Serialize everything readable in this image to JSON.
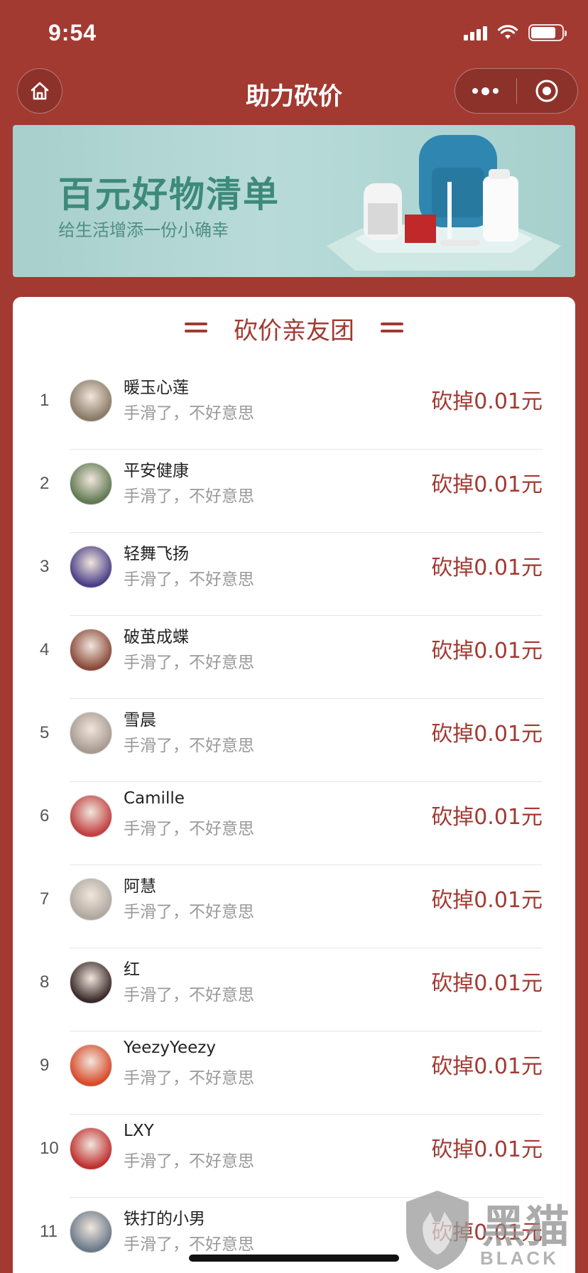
{
  "status_bar": {
    "time": "9:54",
    "battery_level": 0.8
  },
  "nav": {
    "title": "助力砍价"
  },
  "banner": {
    "title": "百元好物清单",
    "subtitle": "给生活增添一份小确幸"
  },
  "section": {
    "title": "砍价亲友团"
  },
  "helpers": [
    {
      "rank": "1",
      "name": "暖玉心莲",
      "message": "手滑了，不好意思",
      "amount": "砍掉0.01元",
      "avatar_color": "#8a7a66"
    },
    {
      "rank": "2",
      "name": "平安健康",
      "message": "手滑了，不好意思",
      "amount": "砍掉0.01元",
      "avatar_color": "#5f7a52"
    },
    {
      "rank": "3",
      "name": "轻舞飞扬",
      "message": "手滑了，不好意思",
      "amount": "砍掉0.01元",
      "avatar_color": "#4a3f88"
    },
    {
      "rank": "4",
      "name": "破茧成蝶",
      "message": "手滑了，不好意思",
      "amount": "砍掉0.01元",
      "avatar_color": "#8a4a3a"
    },
    {
      "rank": "5",
      "name": "雪晨",
      "message": "手滑了，不好意思",
      "amount": "砍掉0.01元",
      "avatar_color": "#a89a90"
    },
    {
      "rank": "6",
      "name": "Camille",
      "message": "手滑了，不好意思",
      "amount": "砍掉0.01元",
      "avatar_color": "#c04040"
    },
    {
      "rank": "7",
      "name": "阿慧",
      "message": "手滑了，不好意思",
      "amount": "砍掉0.01元",
      "avatar_color": "#b0a8a0"
    },
    {
      "rank": "8",
      "name": "红",
      "message": "手滑了，不好意思",
      "amount": "砍掉0.01元",
      "avatar_color": "#3a2a2a"
    },
    {
      "rank": "9",
      "name": "YeezyYeezy",
      "message": "手滑了，不好意思",
      "amount": "砍掉0.01元",
      "avatar_color": "#d84a2a"
    },
    {
      "rank": "10",
      "name": "LXY",
      "message": "手滑了，不好意思",
      "amount": "砍掉0.01元",
      "avatar_color": "#c03030"
    },
    {
      "rank": "11",
      "name": "铁打的小男",
      "message": "手滑了，不好意思",
      "amount": "砍掉0.01元",
      "avatar_color": "#6a7a8a"
    }
  ],
  "watermark": {
    "cn": "黑猫",
    "en": "BLACK CAT"
  },
  "colors": {
    "brand": "#a23a32",
    "banner_bg": "#b8dbd8",
    "banner_text": "#3d8a78"
  }
}
